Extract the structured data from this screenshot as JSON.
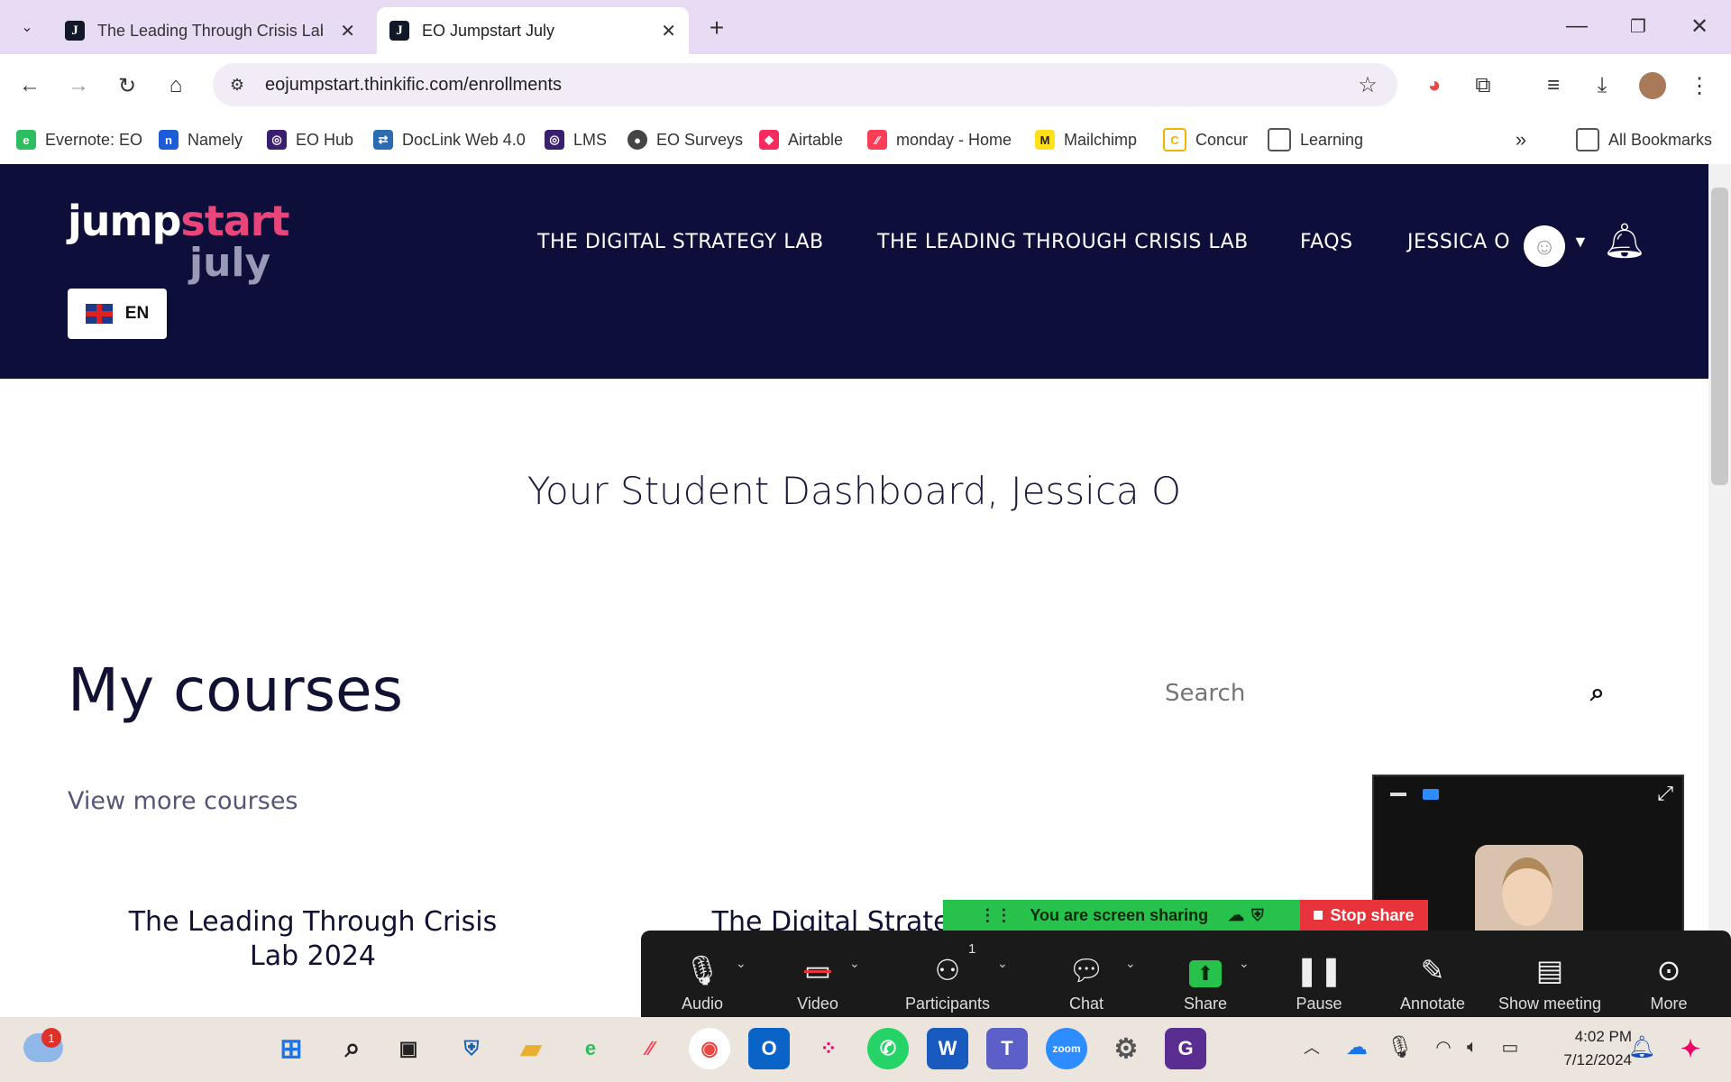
{
  "browser": {
    "tabs": [
      {
        "title": "The Leading Through Crisis Lab",
        "favicon": "J"
      },
      {
        "title": "EO Jumpstart July",
        "favicon": "J"
      }
    ],
    "url": "eojumpstart.thinkific.com/enrollments",
    "bookmarks": [
      {
        "label": "Evernote: EO",
        "color": "#2dbe60"
      },
      {
        "label": "Namely",
        "color": "#1e5bd8"
      },
      {
        "label": "EO Hub",
        "color": "#3a1f6e"
      },
      {
        "label": "DocLink Web 4.0",
        "color": "#2b6cb0"
      },
      {
        "label": "LMS",
        "color": "#3a1f6e"
      },
      {
        "label": "EO Surveys",
        "color": "#444444"
      },
      {
        "label": "Airtable",
        "color": "#f82b60"
      },
      {
        "label": "monday - Home",
        "color": "#ff3d57"
      },
      {
        "label": "Mailchimp",
        "color": "#ffe01b"
      },
      {
        "label": "Concur",
        "color": "#f0b400"
      },
      {
        "label": "Learning",
        "color": "#555555"
      }
    ],
    "all_bookmarks": "All Bookmarks"
  },
  "site": {
    "logo_top": "jump",
    "logo_top_accent": "start",
    "logo_bottom": "july",
    "nav": [
      "THE DIGITAL STRATEGY LAB",
      "THE LEADING THROUGH CRISIS LAB",
      "FAQS"
    ],
    "user": "JESSICA O",
    "language": "EN",
    "colors": {
      "header_bg": "#0e0e3a",
      "accent_pink": "#e8457a",
      "logo_gray": "#9a9ab8"
    }
  },
  "main": {
    "dashboard_title": "Your Student Dashboard, Jessica O",
    "courses_heading": "My courses",
    "search_placeholder": "Search",
    "view_more": "View more courses",
    "courses": [
      {
        "title_line1": "The Leading Through Crisis",
        "title_line2": "Lab 2024"
      },
      {
        "title_line1": "The Digital Strategy",
        "title_line2": ""
      }
    ]
  },
  "zoom": {
    "banner": "You are screen sharing",
    "stop_share": "Stop share",
    "participants_count": "1",
    "controls": [
      "Audio",
      "Video",
      "Participants",
      "Chat",
      "Share",
      "Pause",
      "Annotate",
      "Show meeting",
      "More"
    ]
  },
  "taskbar": {
    "time": "4:02 PM",
    "date": "7/12/2024",
    "weather_badge": "1"
  }
}
